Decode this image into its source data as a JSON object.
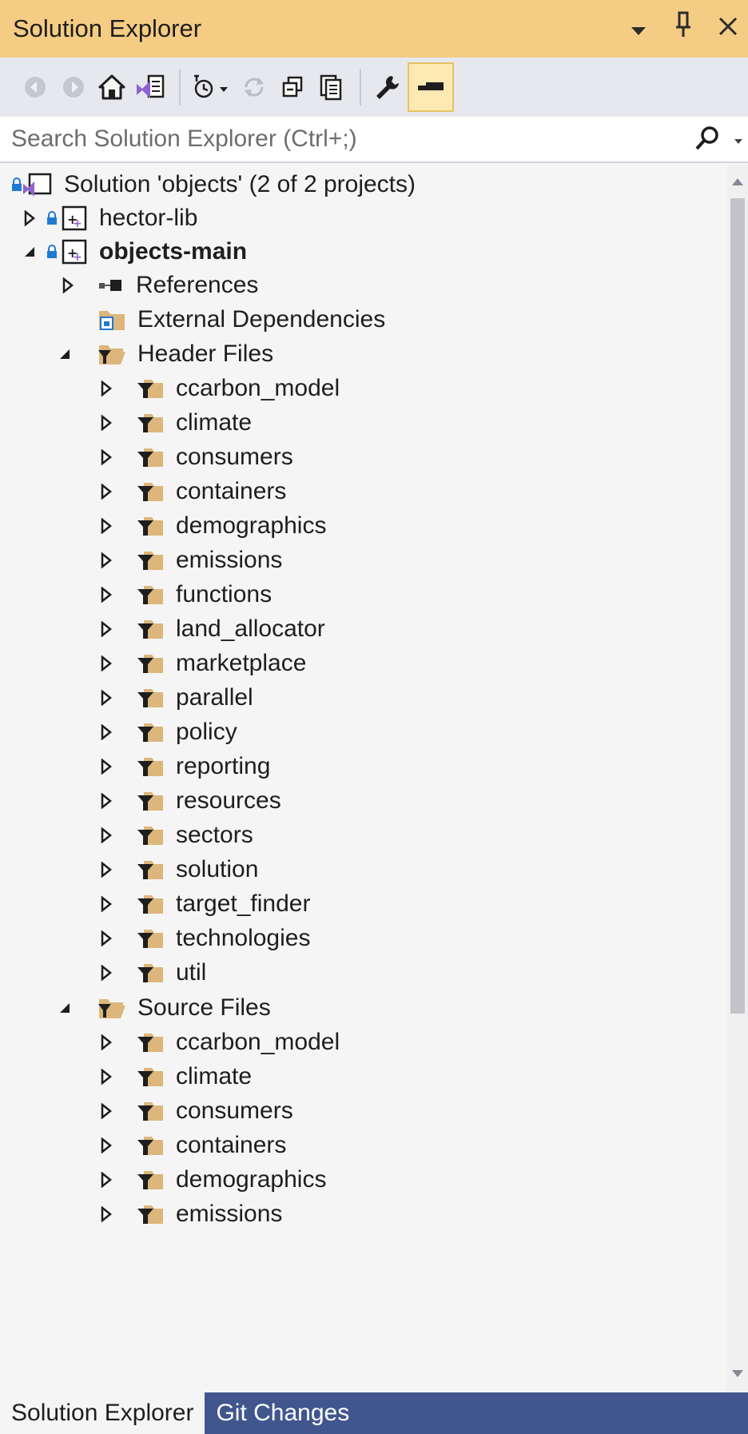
{
  "window": {
    "title": "Solution Explorer",
    "controls": [
      "dropdown-icon",
      "pin-icon",
      "close-icon"
    ]
  },
  "toolbar": {
    "buttons": [
      "back-icon",
      "forward-icon",
      "home-icon",
      "switch-views-icon",
      "pending-changes-filter-icon",
      "sync-icon",
      "collapse-all-icon",
      "show-all-files-icon",
      "properties-icon",
      "preview-selected-items-icon"
    ]
  },
  "search": {
    "placeholder": "Search Solution Explorer (Ctrl+;)"
  },
  "tree": {
    "solution": "Solution 'objects' (2 of 2 projects)",
    "projects": [
      {
        "label": "hector-lib",
        "expanded": false,
        "bold": false
      },
      {
        "label": "objects-main",
        "expanded": true,
        "bold": true
      }
    ],
    "references": "References",
    "external_dependencies": "External Dependencies",
    "header_files": {
      "label": "Header Files",
      "folders": [
        "ccarbon_model",
        "climate",
        "consumers",
        "containers",
        "demographics",
        "emissions",
        "functions",
        "land_allocator",
        "marketplace",
        "parallel",
        "policy",
        "reporting",
        "resources",
        "sectors",
        "solution",
        "target_finder",
        "technologies",
        "util"
      ]
    },
    "source_files": {
      "label": "Source Files",
      "folders": [
        "ccarbon_model",
        "climate",
        "consumers",
        "containers",
        "demographics",
        "emissions"
      ]
    }
  },
  "tabs": [
    "Solution Explorer",
    "Git Changes"
  ],
  "colors": {
    "title_bg": "#f5cc84",
    "toolbar_bg": "#e6e8ee",
    "tab_bar_bg": "#40568d",
    "folder": "#dcb67a",
    "vs_purple": "#8f62ce"
  }
}
